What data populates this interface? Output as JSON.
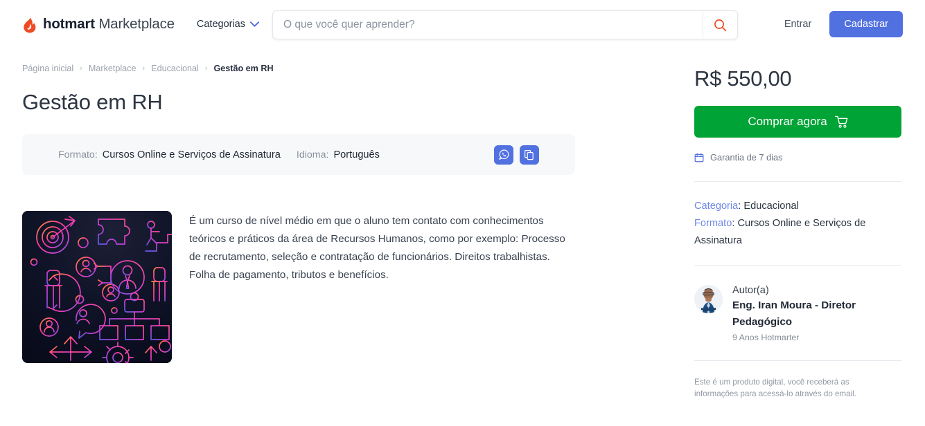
{
  "header": {
    "brand_bold": "hotmart",
    "brand_light": "Marketplace",
    "logo_icon": "hotmart-flame-icon",
    "categories_label": "Categorias",
    "chevron_icon": "chevron-down-icon",
    "search": {
      "placeholder": "O que você quer aprender?",
      "value": "",
      "icon": "search-icon"
    },
    "login_label": "Entrar",
    "signup_label": "Cadastrar",
    "accent_blue": "#5271e0",
    "accent_orange": "#ef4a23"
  },
  "breadcrumb": {
    "items": [
      {
        "label": "Página inicial",
        "current": false
      },
      {
        "label": "Marketplace",
        "current": false
      },
      {
        "label": "Educacional",
        "current": false
      },
      {
        "label": "Gestão em RH",
        "current": true
      }
    ],
    "separator": "›"
  },
  "product": {
    "title": "Gestão em RH",
    "info_bar": {
      "format_label": "Formato:",
      "format_value": "Cursos Online e Serviços de Assinatura",
      "language_label": "Idioma:",
      "language_value": "Português",
      "share_whatsapp_icon": "whatsapp-icon",
      "share_copy_icon": "copy-link-icon"
    },
    "thumbnail_alt": "hr-management-neon-illustration",
    "description": "É um curso de nível médio em que o aluno tem contato com conhecimentos teóricos e práticos da área de Recursos Humanos, como por exemplo: Processo de recrutamento, seleção e contratação de funcionários. Direitos trabalhistas. Folha de pagamento, tributos e benefícios."
  },
  "sidebar": {
    "price": "R$ 550,00",
    "buy_label": "Comprar agora",
    "cart_icon": "shopping-cart-icon",
    "buy_color": "#00a335",
    "guarantee_icon": "calendar-icon",
    "guarantee_label": "Garantia de 7 dias",
    "category_key": "Categoria",
    "category_value": "Educacional",
    "format_key": "Formato",
    "format_value": "Cursos Online e Serviços de Assinatura",
    "author": {
      "avatar_alt": "author-avatar",
      "role_label": "Autor(a)",
      "name": "Eng. Iran Moura - Diretor Pedagógico",
      "tenure": "9 Anos Hotmarter"
    },
    "footnote": "Este é um produto digital, você receberá as informações para acessá-lo através do email."
  }
}
